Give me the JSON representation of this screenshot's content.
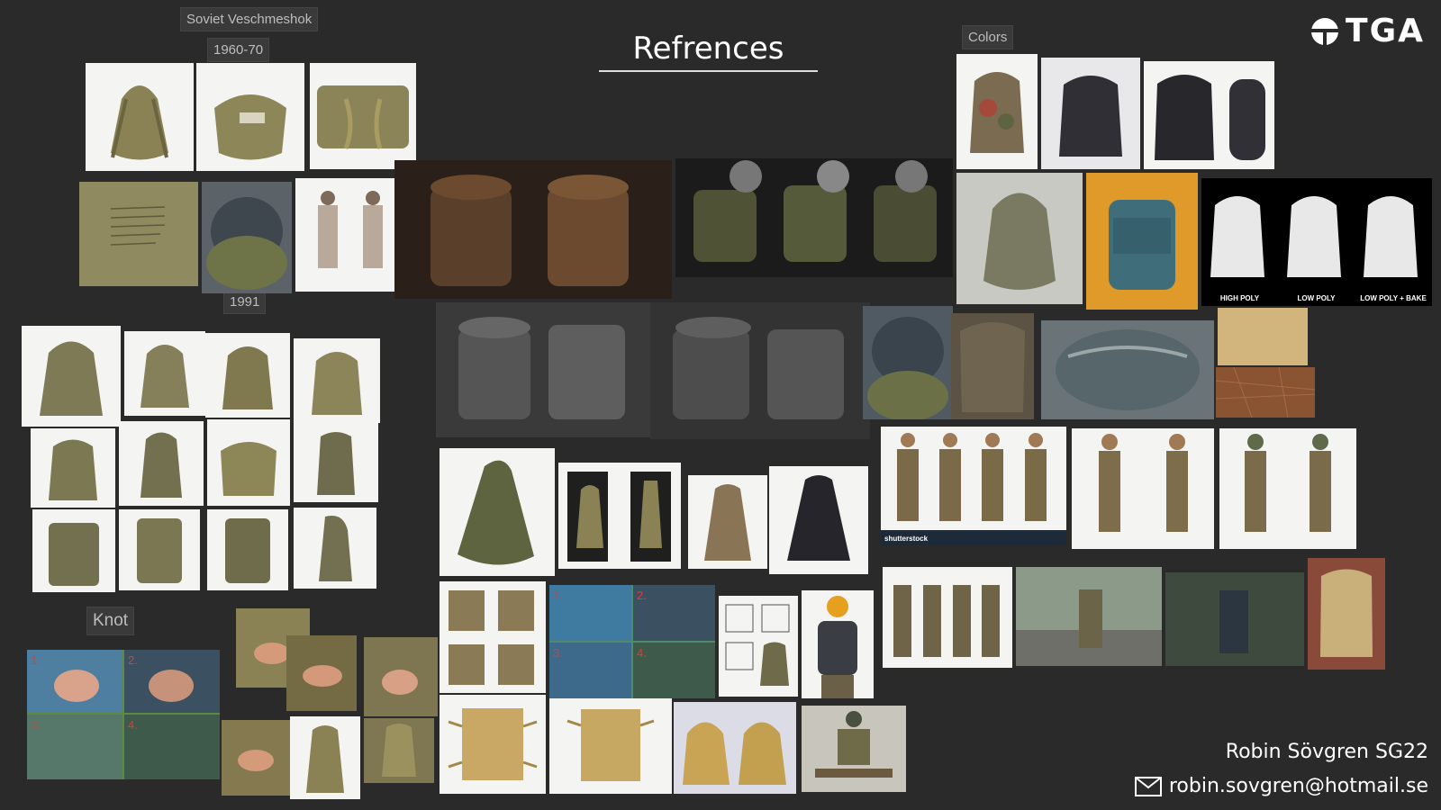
{
  "header": {
    "title": "Refrences",
    "logo_text": "TGA"
  },
  "labels": {
    "soviet": "Soviet Veschmeshok",
    "era1": "1960-70",
    "era2": "1991",
    "colors": "Colors",
    "knot": "Knot"
  },
  "captions": {
    "high_poly": "HIGH POLY",
    "low_poly": "LOW POLY",
    "low_poly_bake": "LOW POLY + BAKE",
    "shutterstock": "shutterstock"
  },
  "knot_steps": [
    "1.",
    "2.",
    "3.",
    "4."
  ],
  "footer": {
    "author": "Robin Sövgren SG22",
    "email": "robin.sovgren@hotmail.se"
  },
  "colors": {
    "background": "#2a2a2a",
    "khaki": "#8a8254",
    "olive": "#5e6440",
    "brown": "#6b4a30",
    "dark_bag": "#2f2f35",
    "tan": "#c9a866"
  }
}
